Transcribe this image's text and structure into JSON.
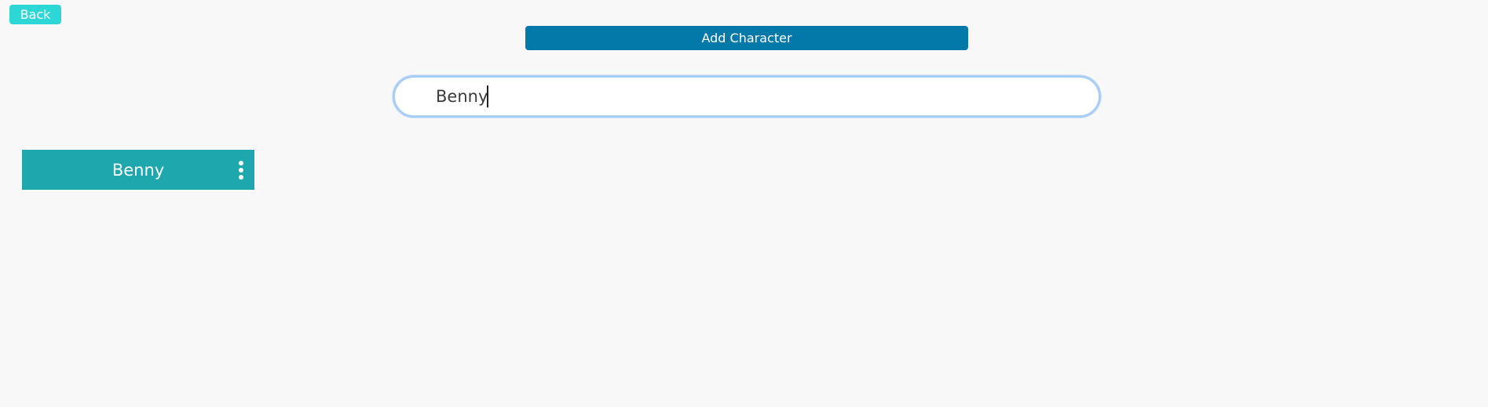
{
  "header": {
    "back_label": "Back",
    "add_label": "Add Character"
  },
  "search": {
    "value": "Benny",
    "placeholder": ""
  },
  "characters": [
    {
      "name": "Benny",
      "menu_icon": "more-vertical-icon"
    }
  ],
  "colors": {
    "background": "#f8f8f8",
    "back_button": "#2dd7d6",
    "add_button": "#0379a9",
    "card": "#1fa7ae",
    "search_focus_border": "#a9cdf4"
  }
}
